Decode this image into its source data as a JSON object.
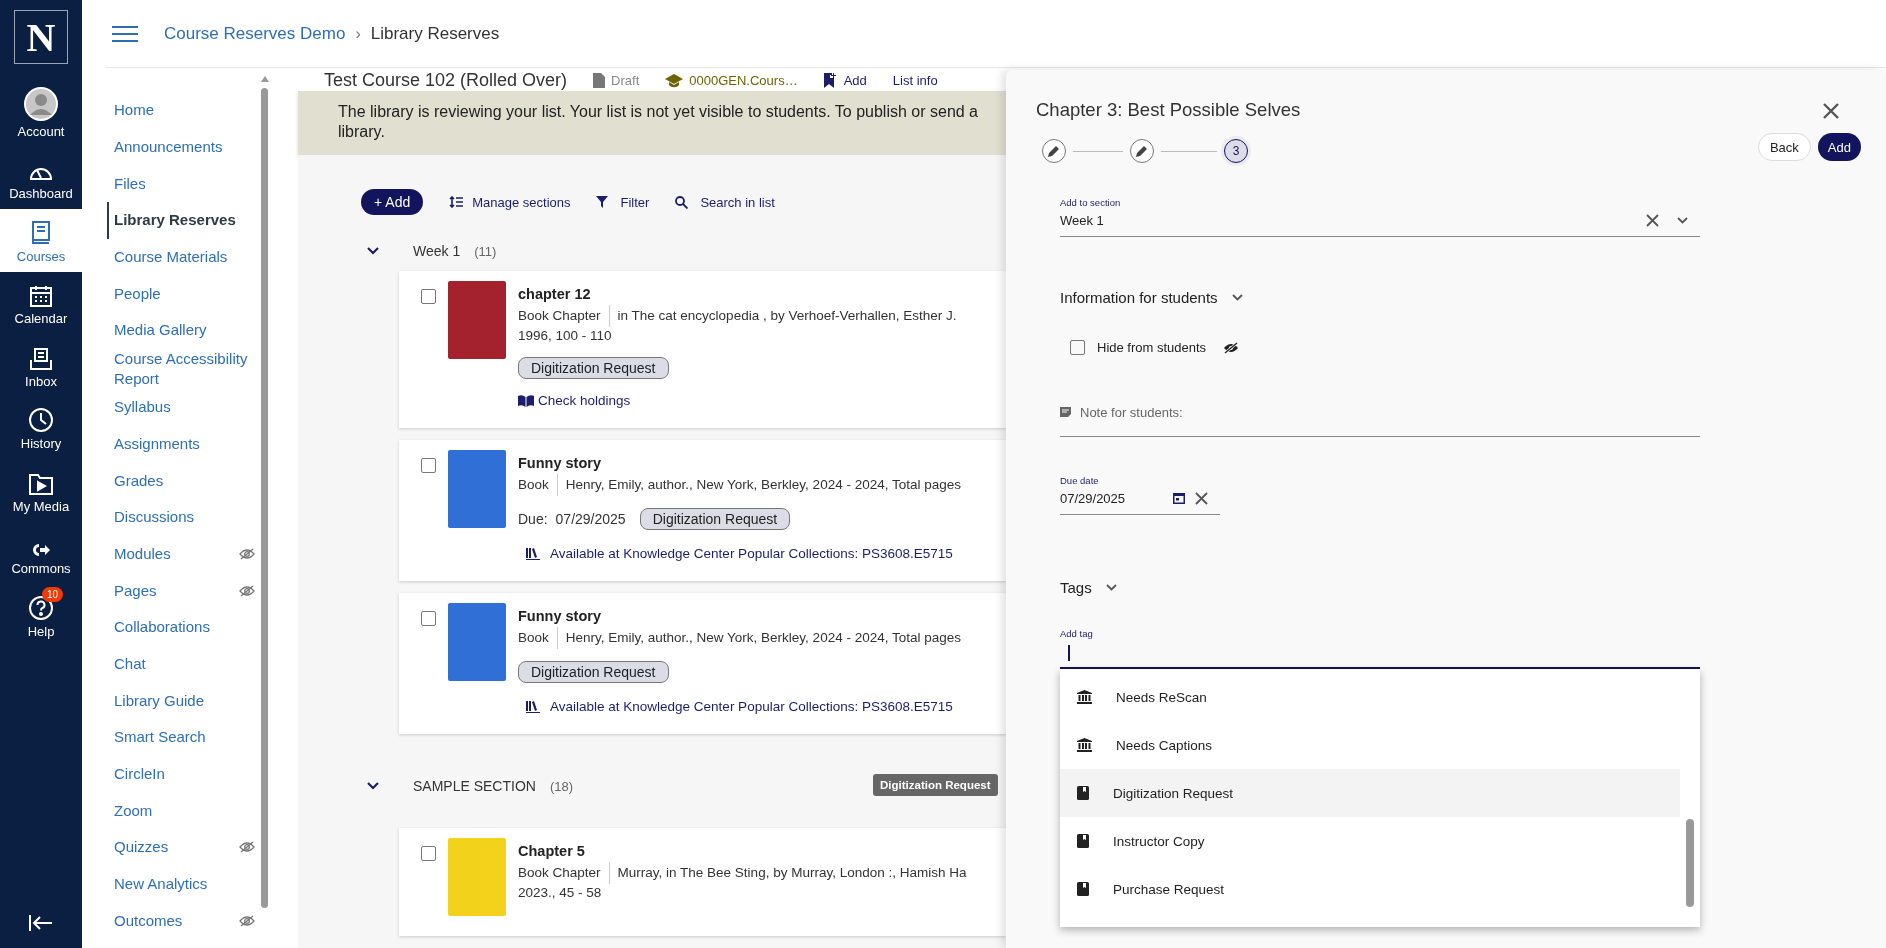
{
  "global_nav": {
    "logo": "N",
    "items": [
      {
        "label": "Account",
        "kind": "avatar",
        "selected": false
      },
      {
        "label": "Dashboard",
        "kind": "gauge",
        "selected": false
      },
      {
        "label": "Courses",
        "kind": "book",
        "selected": true
      },
      {
        "label": "Calendar",
        "kind": "calendar",
        "selected": false
      },
      {
        "label": "Inbox",
        "kind": "inbox",
        "selected": false
      },
      {
        "label": "History",
        "kind": "clock",
        "selected": false
      },
      {
        "label": "My Media",
        "kind": "media",
        "selected": false
      },
      {
        "label": "Commons",
        "kind": "commons",
        "selected": false
      },
      {
        "label": "Help",
        "kind": "help",
        "selected": false,
        "badge": "10"
      }
    ]
  },
  "header": {
    "breadcrumb": [
      {
        "label": "Course Reserves Demo",
        "kind": "link"
      },
      {
        "label": "Library Reserves",
        "kind": "current"
      }
    ],
    "separator": "›"
  },
  "course_nav": {
    "items": [
      {
        "label": "Home",
        "selected": false,
        "hidden": false
      },
      {
        "label": "Announcements",
        "selected": false,
        "hidden": false
      },
      {
        "label": "Files",
        "selected": false,
        "hidden": false
      },
      {
        "label": "Library Reserves",
        "selected": true,
        "hidden": false
      },
      {
        "label": "Course Materials",
        "selected": false,
        "hidden": false
      },
      {
        "label": "People",
        "selected": false,
        "hidden": false
      },
      {
        "label": "Media Gallery",
        "selected": false,
        "hidden": false
      },
      {
        "label": "Course Accessibility Report",
        "selected": false,
        "hidden": false
      },
      {
        "label": "Syllabus",
        "selected": false,
        "hidden": false
      },
      {
        "label": "Assignments",
        "selected": false,
        "hidden": false
      },
      {
        "label": "Grades",
        "selected": false,
        "hidden": false
      },
      {
        "label": "Discussions",
        "selected": false,
        "hidden": false
      },
      {
        "label": "Modules",
        "selected": false,
        "hidden": true
      },
      {
        "label": "Pages",
        "selected": false,
        "hidden": true
      },
      {
        "label": "Collaborations",
        "selected": false,
        "hidden": false
      },
      {
        "label": "Chat",
        "selected": false,
        "hidden": false
      },
      {
        "label": "Library Guide",
        "selected": false,
        "hidden": false
      },
      {
        "label": "Smart Search",
        "selected": false,
        "hidden": false
      },
      {
        "label": "CircleIn",
        "selected": false,
        "hidden": false
      },
      {
        "label": "Zoom",
        "selected": false,
        "hidden": false
      },
      {
        "label": "Quizzes",
        "selected": false,
        "hidden": true
      },
      {
        "label": "New Analytics",
        "selected": false,
        "hidden": false
      },
      {
        "label": "Outcomes",
        "selected": false,
        "hidden": true
      }
    ]
  },
  "list_header": {
    "title": "Test Course 102 (Rolled Over)",
    "status": "Draft",
    "course_code": "0000GEN.Cours…",
    "add": "Add",
    "list_info": "List info"
  },
  "banner": "The library is reviewing your list. Your list is not yet visible to students. To publish or send a library.",
  "toolbar": {
    "add": "+ Add",
    "manage": "Manage sections",
    "filter": "Filter",
    "search": "Search in list"
  },
  "sections": [
    {
      "title": "Week 1",
      "count": "(11)",
      "expanded": true,
      "items": [
        {
          "title": "chapter 12",
          "type": "Book Chapter",
          "details": "in The cat encyclopedia , by Verhoef-Verhallen, Esther J.",
          "details_2": "1996, 100 - 110",
          "color": "#a3222e",
          "checked": false,
          "tags": [
            "Digitization Request"
          ],
          "holdings": {
            "kind": "check",
            "label": "Check holdings"
          }
        },
        {
          "title": "Funny story",
          "type": "Book",
          "details": "Henry, Emily, author., New York, Berkley, 2024 - 2024, Total pages",
          "color": "#2f6fd6",
          "checked": false,
          "due_label": "Due:",
          "due": "07/29/2025",
          "tags": [
            "Digitization Request"
          ],
          "holdings": {
            "kind": "available",
            "label": "Available at Knowledge Center Popular Collections: PS3608.E5715"
          }
        },
        {
          "title": "Funny story",
          "type": "Book",
          "details": "Henry, Emily, author., New York, Berkley, 2024 - 2024, Total pages",
          "color": "#2f6fd6",
          "checked": false,
          "tags": [
            "Digitization Request"
          ],
          "holdings": {
            "kind": "available",
            "label": "Available at Knowledge Center Popular Collections: PS3608.E5715"
          }
        }
      ]
    },
    {
      "title": "SAMPLE SECTION",
      "count": "(18)",
      "expanded": true,
      "items": [
        {
          "title": "Chapter 5",
          "type": "Book Chapter",
          "details": "Murray, in The Bee Sting, by Murray, London :, Hamish Ha",
          "details_2": "2023., 45 - 58",
          "color": "#f2d21b",
          "checked": false
        }
      ]
    }
  ],
  "tooltip": "Digitization Request",
  "panel": {
    "title": "Chapter 3: Best Possible Selves",
    "steps": [
      {
        "kind": "done"
      },
      {
        "kind": "done"
      },
      {
        "kind": "current",
        "label": "3"
      }
    ],
    "back": "Back",
    "add": "Add",
    "section_field": {
      "label": "Add to section",
      "value": "Week 1"
    },
    "info_heading": "Information for students",
    "hide": {
      "label": "Hide from students",
      "checked": false
    },
    "note": {
      "placeholder": "Note for students:"
    },
    "due": {
      "label": "Due date",
      "value": "07/29/2025"
    },
    "tags_heading": "Tags",
    "tag_field": {
      "label": "Add tag"
    },
    "tag_options": [
      {
        "label": "Needs ReScan",
        "kind": "institution",
        "selected": false
      },
      {
        "label": "Needs Captions",
        "kind": "institution",
        "selected": false
      },
      {
        "label": "Digitization Request",
        "kind": "bookmark",
        "selected": true
      },
      {
        "label": "Instructor Copy",
        "kind": "bookmark",
        "selected": false
      },
      {
        "label": "Purchase Request",
        "kind": "bookmark",
        "selected": false
      }
    ]
  }
}
